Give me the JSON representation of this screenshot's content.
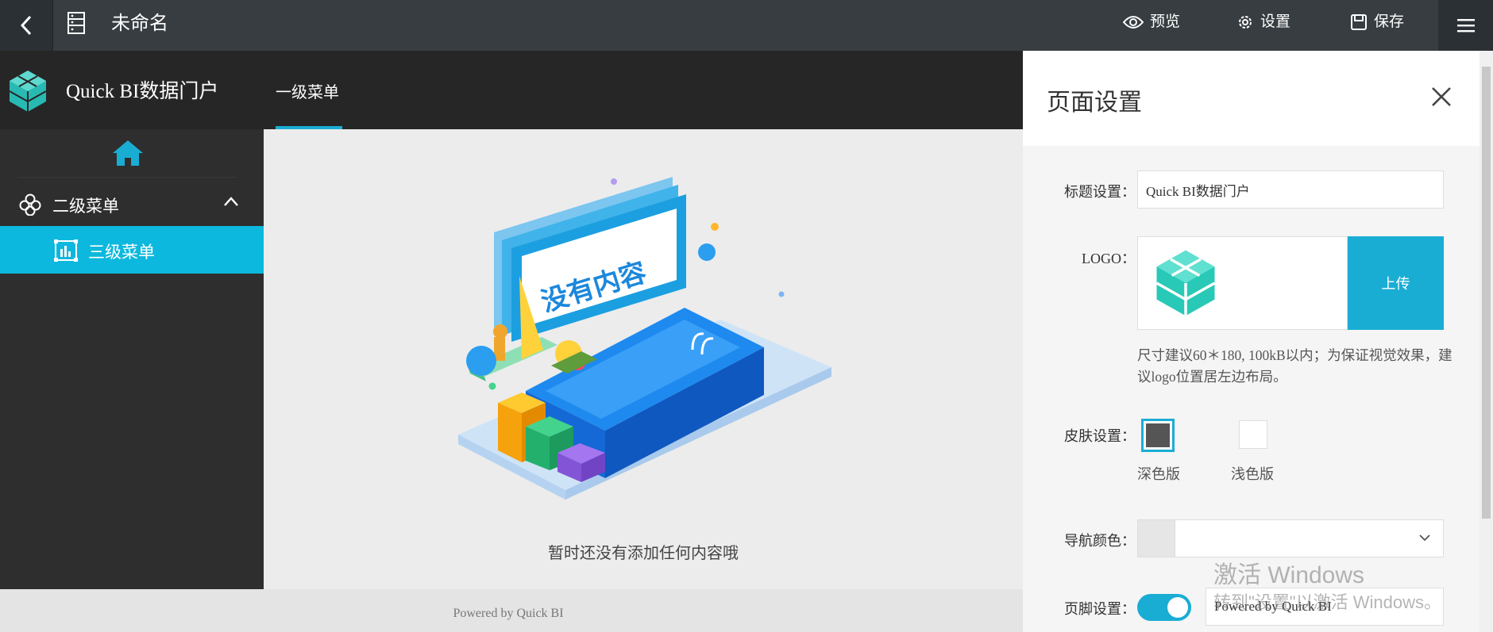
{
  "topbar": {
    "back_icon": "chevron-left-icon",
    "doc_icon": "document-list-icon",
    "title": "未命名",
    "actions": [
      {
        "icon": "eye-icon",
        "label": "预览"
      },
      {
        "icon": "gear-icon",
        "label": "设置"
      },
      {
        "icon": "save-icon",
        "label": "保存"
      }
    ],
    "menu_icon": "hamburger-icon"
  },
  "portal": {
    "brand": "Quick BI数据门户",
    "tab": "一级菜单",
    "sidebar": {
      "home_icon": "home-icon",
      "level2": {
        "label": "二级菜单",
        "icon": "cluster-icon",
        "expanded": true
      },
      "level3": {
        "label": "三级菜单",
        "icon": "chart-icon",
        "selected": true
      }
    },
    "empty_text": "暂时还没有添加任何内容哦",
    "illustration_text": "没有内容",
    "footer_text": "Powered by Quick BI"
  },
  "settings_panel": {
    "title": "页面设置",
    "close_icon": "close-icon",
    "title_setting": {
      "label": "标题设置：",
      "value": "Quick BI数据门户"
    },
    "logo": {
      "label": "LOGO：",
      "upload_label": "上传",
      "hint": "尺寸建议60＊180, 100kB以内；为保证视觉效果，建议logo位置居左边布局。"
    },
    "skin": {
      "label": "皮肤设置：",
      "options": [
        {
          "label": "深色版",
          "selected": true
        },
        {
          "label": "浅色版",
          "selected": false
        }
      ]
    },
    "nav_color": {
      "label": "导航颜色：",
      "value": ""
    },
    "footer": {
      "label": "页脚设置：",
      "enabled": true,
      "value": "Powered by Quick BI"
    }
  },
  "watermark": {
    "line1": "激活 Windows",
    "line2": "转到\"设置\"以激活 Windows。"
  },
  "colors": {
    "topbar": "#373d41",
    "header": "#262626",
    "sidebar": "#2e2e2e",
    "accent": "#1aadd4",
    "selected_item": "#0cb8dd"
  }
}
